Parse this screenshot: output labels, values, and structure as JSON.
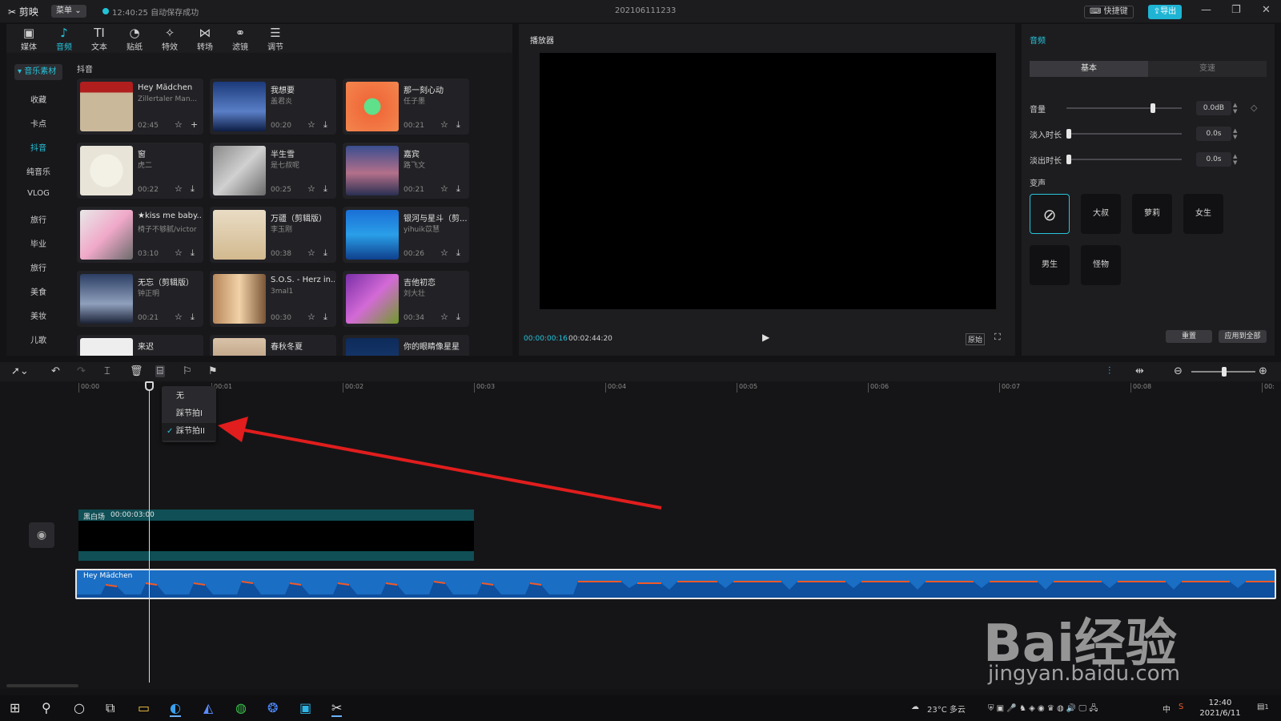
{
  "titlebar": {
    "app_name": "剪映",
    "menu_label": "菜单",
    "save_status": "12:40:25 自动保存成功",
    "project_name": "202106111233",
    "shortcut_label": "快捷键",
    "export_label": "导出"
  },
  "toolbar": {
    "tools": [
      {
        "label": "媒体",
        "icon": "media-icon"
      },
      {
        "label": "音频",
        "icon": "audio-icon"
      },
      {
        "label": "文本",
        "icon": "text-icon"
      },
      {
        "label": "贴纸",
        "icon": "sticker-icon"
      },
      {
        "label": "特效",
        "icon": "effects-icon"
      },
      {
        "label": "转场",
        "icon": "transition-icon"
      },
      {
        "label": "滤镜",
        "icon": "filter-icon"
      },
      {
        "label": "调节",
        "icon": "adjust-icon"
      }
    ]
  },
  "sidebar": {
    "header": "音乐素材",
    "items": [
      "收藏",
      "卡点",
      "抖音",
      "纯音乐",
      "VLOG",
      "旅行",
      "毕业",
      "旅行",
      "美食",
      "美妆",
      "儿歌"
    ]
  },
  "library": {
    "title": "抖音",
    "cards": [
      {
        "name": "Hey Mädchen",
        "artist": "Zillertaler Man...",
        "duration": "02:45"
      },
      {
        "name": "我想要",
        "artist": "盖君炎",
        "duration": "00:20"
      },
      {
        "name": "那一刻心动",
        "artist": "任子墨",
        "duration": "00:21"
      },
      {
        "name": "窗",
        "artist": "虎二",
        "duration": "00:22"
      },
      {
        "name": "半生雪",
        "artist": "是七叔呢",
        "duration": "00:25"
      },
      {
        "name": "嘉宾",
        "artist": "路飞文",
        "duration": "00:21"
      },
      {
        "name": "★kiss me baby...",
        "artist": "椅子不够腻/victor",
        "duration": "03:10"
      },
      {
        "name": "万疆（剪辑版）",
        "artist": "李玉刚",
        "duration": "00:38"
      },
      {
        "name": "银河与星斗（剪...",
        "artist": "yihuik苡慧",
        "duration": "00:26"
      },
      {
        "name": "无忘（剪辑版）",
        "artist": "钟正明",
        "duration": "00:21"
      },
      {
        "name": "S.O.S. - Herz in...",
        "artist": "3mal1",
        "duration": "00:30"
      },
      {
        "name": "吉他初恋",
        "artist": "刘大壮",
        "duration": "00:34"
      },
      {
        "name": "来迟",
        "artist": "",
        "duration": ""
      },
      {
        "name": "春秋冬夏",
        "artist": "",
        "duration": ""
      },
      {
        "name": "你的眼睛像星星",
        "artist": "",
        "duration": ""
      }
    ]
  },
  "player": {
    "title": "播放器",
    "current_time": "00:00:00:16",
    "total_time": "00:02:44:20",
    "original_label": "原始"
  },
  "audio_panel": {
    "title": "音频",
    "tab_basic": "基本",
    "tab_speed": "变速",
    "volume_label": "音量",
    "volume_value": "0.0dB",
    "volume_level": 0.75,
    "fade_in_label": "淡入时长",
    "fade_in_value": "0.0s",
    "fade_out_label": "淡出时长",
    "fade_out_value": "0.0s",
    "voice_change_label": "变声",
    "voices": [
      "大叔",
      "萝莉",
      "女生",
      "男生",
      "怪物"
    ],
    "reset_label": "重置",
    "apply_all_label": "应用到全部"
  },
  "timeline": {
    "ruler_ticks": [
      "00:00",
      "00:01",
      "00:02",
      "00:03",
      "00:04",
      "00:05",
      "00:06",
      "00:07",
      "00:08",
      "00:"
    ],
    "beat_menu": {
      "items": [
        "无",
        "踩节拍I",
        "踩节拍II"
      ],
      "checked_index": 2
    },
    "video_clip": {
      "label": "黑白场",
      "duration": "00:00:03:00"
    },
    "audio_clip": {
      "label": "Hey Mädchen"
    }
  },
  "watermark": {
    "brand": "Bai经验",
    "url": "jingyan.baidu.com"
  },
  "taskbar": {
    "weather": "23°C 多云",
    "ime": "中",
    "time": "12:40",
    "date": "2021/6/11",
    "notifications": "1"
  },
  "colors": {
    "accent": "#27c4db",
    "export": "#1fb4d4",
    "video_clip": "#0f4f55",
    "audio_clip": "#1a6ec4",
    "arrow": "#e11d1d"
  }
}
